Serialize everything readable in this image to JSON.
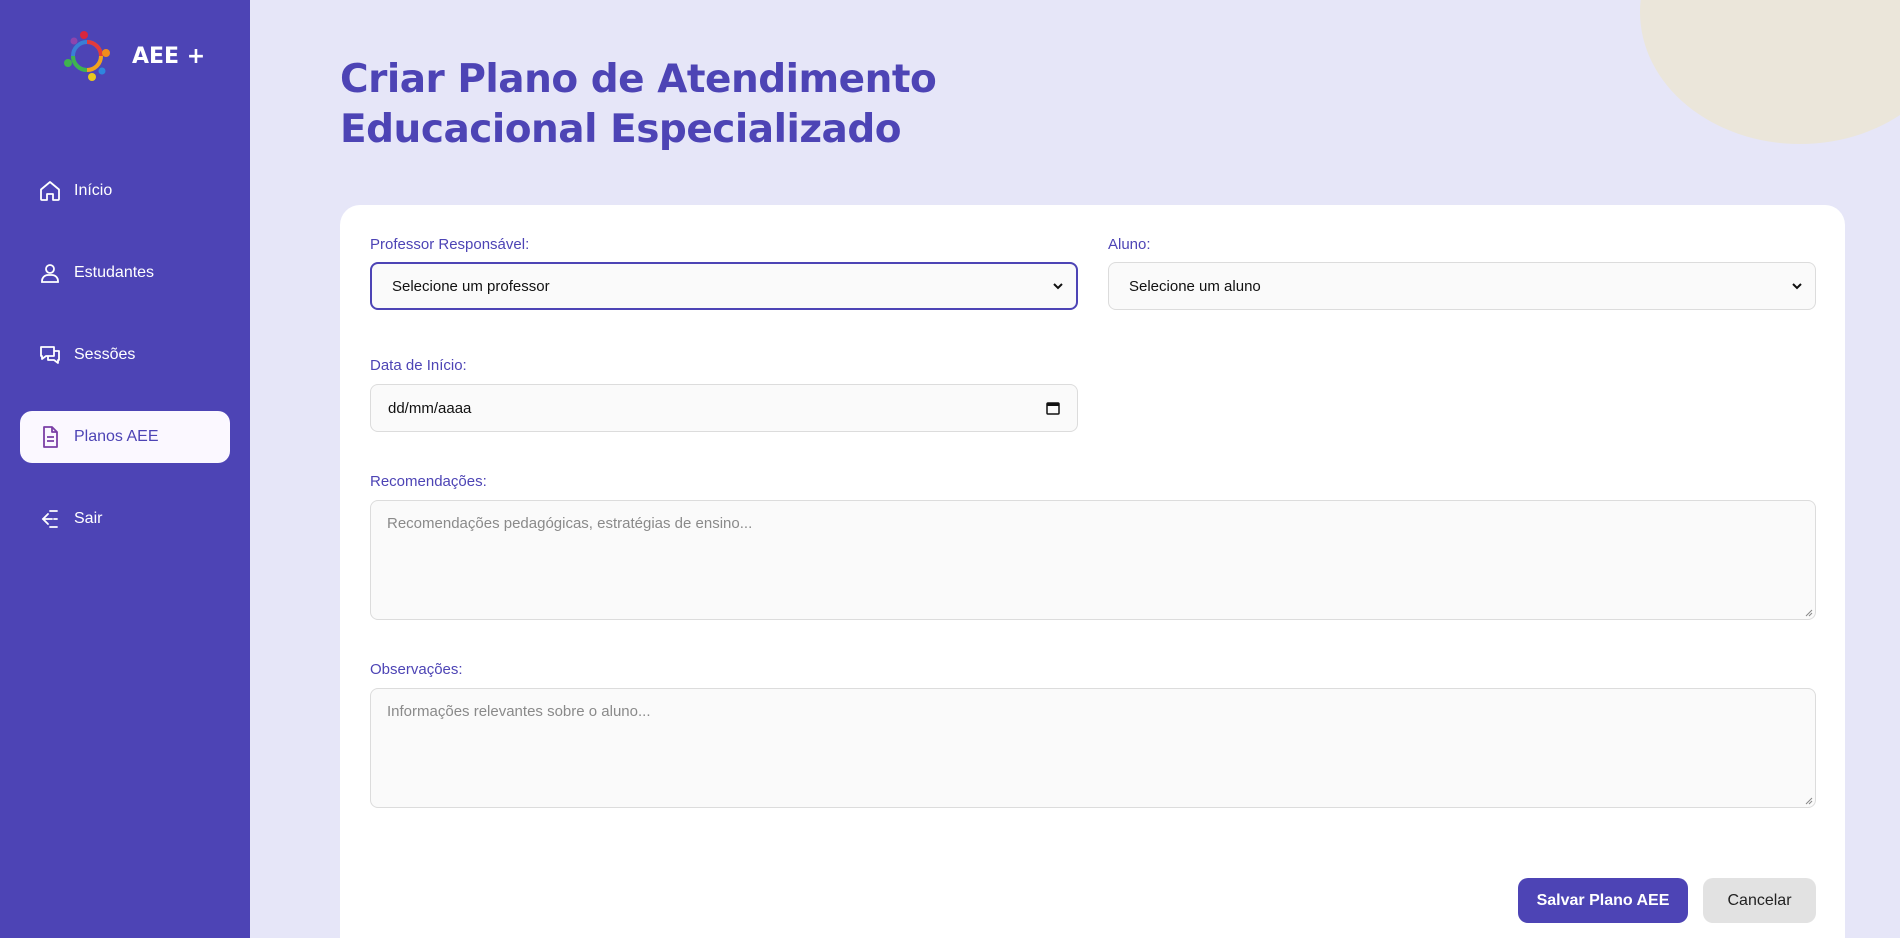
{
  "sidebar": {
    "brand": "AEE +",
    "items": [
      {
        "label": "Início",
        "icon": "home-icon"
      },
      {
        "label": "Estudantes",
        "icon": "user-icon"
      },
      {
        "label": "Sessões",
        "icon": "chat-icon"
      },
      {
        "label": "Planos AEE",
        "icon": "document-icon",
        "active": true
      },
      {
        "label": "Sair",
        "icon": "logout-icon"
      }
    ]
  },
  "page": {
    "title_line1": "Criar Plano de Atendimento",
    "title_line2": "Educacional Especializado"
  },
  "form": {
    "professor_label": "Professor Responsável:",
    "professor_value": "Selecione um professor",
    "aluno_label": "Aluno:",
    "aluno_value": "Selecione um aluno",
    "data_label": "Data de Início:",
    "data_value": "dd/mm/aaaa",
    "recomendacoes_label": "Recomendações:",
    "recomendacoes_placeholder": "Recomendações pedagógicas, estratégias de ensino...",
    "observacoes_label": "Observações:",
    "observacoes_placeholder": "Informações relevantes sobre o aluno...",
    "save_label": "Salvar Plano AEE",
    "cancel_label": "Cancelar"
  },
  "colors": {
    "accent": "#4d44b5",
    "background": "#e6e6f8"
  }
}
